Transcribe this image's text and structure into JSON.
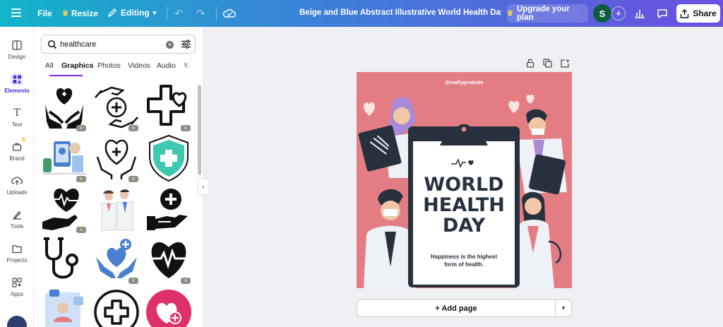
{
  "topbar": {
    "file_label": "File",
    "resize_label": "Resize",
    "editing_label": "Editing",
    "document_title": "Beige and Blue Abstract Illustrative World Health Day Greet...",
    "upgrade_label": "Upgrade your plan",
    "avatar_initial": "S",
    "share_label": "Share"
  },
  "rail": {
    "items": [
      {
        "label": "Design"
      },
      {
        "label": "Elements"
      },
      {
        "label": "Text"
      },
      {
        "label": "Brand"
      },
      {
        "label": "Uploads"
      },
      {
        "label": "Tools"
      },
      {
        "label": "Projects"
      },
      {
        "label": "Apps"
      }
    ]
  },
  "panel": {
    "search_value": "healthcare",
    "tabs": [
      {
        "label": "All"
      },
      {
        "label": "Graphics"
      },
      {
        "label": "Photos"
      },
      {
        "label": "Videos"
      },
      {
        "label": "Audio"
      },
      {
        "label": "S"
      }
    ],
    "active_tab": "Graphics"
  },
  "design": {
    "handle": "@reallygreatsite",
    "title_line1": "WORLD",
    "title_line2": "HEALTH",
    "title_line3": "DAY",
    "tagline_line1": "Happiness is the highest",
    "tagline_line2": "form of health."
  },
  "canvas": {
    "add_page_label": "+ Add page"
  },
  "colors": {
    "accent": "#7d2ae8",
    "design_bg": "#e37d83",
    "dark_ink": "#27313e",
    "heart_blue": "#4a7fd0",
    "shield_teal": "#3ec9b0",
    "heart_pink": "#e0306a"
  }
}
